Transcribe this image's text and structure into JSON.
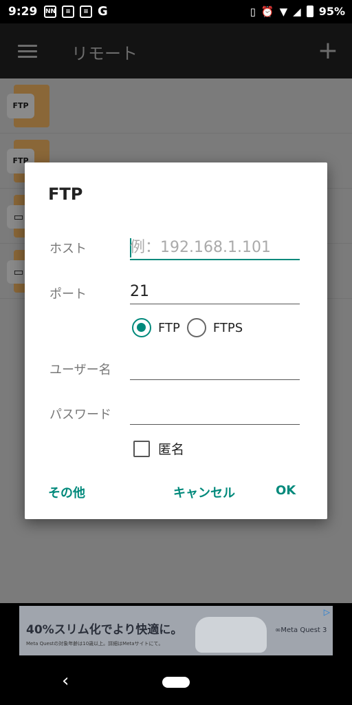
{
  "status_bar": {
    "time": "9:29",
    "left_icons": [
      "nn-icon",
      "news-icon",
      "news-icon-2",
      "google-icon"
    ],
    "google_glyph": "G",
    "nn_glyph": "NN",
    "battery_percent": "95%"
  },
  "app_bar": {
    "title": "リモート"
  },
  "list": {
    "items": [
      {
        "badge": "FTP",
        "type": "folder"
      },
      {
        "badge": "FTP",
        "type": "folder"
      },
      {
        "badge": "",
        "type": "monitor"
      },
      {
        "badge": "",
        "type": "monitor"
      }
    ]
  },
  "dialog": {
    "title": "FTP",
    "host_label": "ホスト",
    "host_value": "",
    "host_placeholder": "例：192.168.1.101",
    "port_label": "ポート",
    "port_value": "21",
    "protocol_options": [
      {
        "label": "FTP",
        "selected": true
      },
      {
        "label": "FTPS",
        "selected": false
      }
    ],
    "user_label": "ユーザー名",
    "user_value": "",
    "password_label": "パスワード",
    "password_value": "",
    "anonymous_label": "匿名",
    "anonymous_checked": false,
    "other_button": "その他",
    "cancel_button": "キャンセル",
    "ok_button": "OK"
  },
  "ad": {
    "headline": "40%スリム化でより快適に。",
    "fine_print": "Meta Questの対象年齢は10歳以上。詳細はMetaサイトにて。",
    "brand": "∞Meta Quest 3",
    "choice_glyph": "▷"
  },
  "colors": {
    "accent": "#00897b",
    "app_bar": "#131313",
    "scrim": "#7b7b7b"
  }
}
